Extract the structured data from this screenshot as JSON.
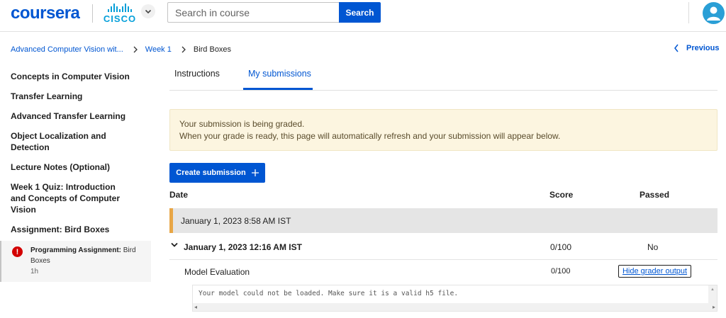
{
  "header": {
    "logo": "coursera",
    "partner_logo": "CISCO",
    "search_placeholder": "Search in course",
    "search_button": "Search"
  },
  "breadcrumb": {
    "course": "Advanced Computer Vision wit...",
    "week": "Week 1",
    "current": "Bird Boxes",
    "previous": "Previous"
  },
  "sidebar": {
    "items": [
      {
        "label": "Concepts in Computer Vision"
      },
      {
        "label": "Transfer Learning"
      },
      {
        "label": "Advanced Transfer Learning"
      },
      {
        "label": "Object Localization and Detection"
      },
      {
        "label": "Lecture Notes (Optional)"
      },
      {
        "label": "Week 1 Quiz: Introduction and Concepts of Computer Vision"
      },
      {
        "label": "Assignment: Bird Boxes"
      }
    ],
    "active_sub": {
      "type": "Programming Assignment:",
      "title": "Bird Boxes",
      "duration": "1h",
      "status_icon": "!"
    }
  },
  "tabs": [
    {
      "label": "Instructions"
    },
    {
      "label": "My submissions"
    }
  ],
  "notice": {
    "line1": "Your submission is being graded.",
    "line2": "When your grade is ready, this page will automatically refresh and your submission will appear below."
  },
  "create_button": "Create submission",
  "table": {
    "headers": {
      "date": "Date",
      "score": "Score",
      "passed": "Passed"
    },
    "pending": {
      "date": "January 1, 2023 8:58 AM IST"
    },
    "submission": {
      "date": "January 1, 2023 12:16 AM IST",
      "score": "0/100",
      "passed": "No"
    },
    "evaluation": {
      "label": "Model Evaluation",
      "score": "0/100",
      "toggle": "Hide grader output"
    },
    "grader_output": "Your model could not be loaded. Make sure it is a valid h5 file."
  },
  "colors": {
    "brand": "#0056d2",
    "pending_accent": "#e8a646",
    "error": "#d30001"
  }
}
